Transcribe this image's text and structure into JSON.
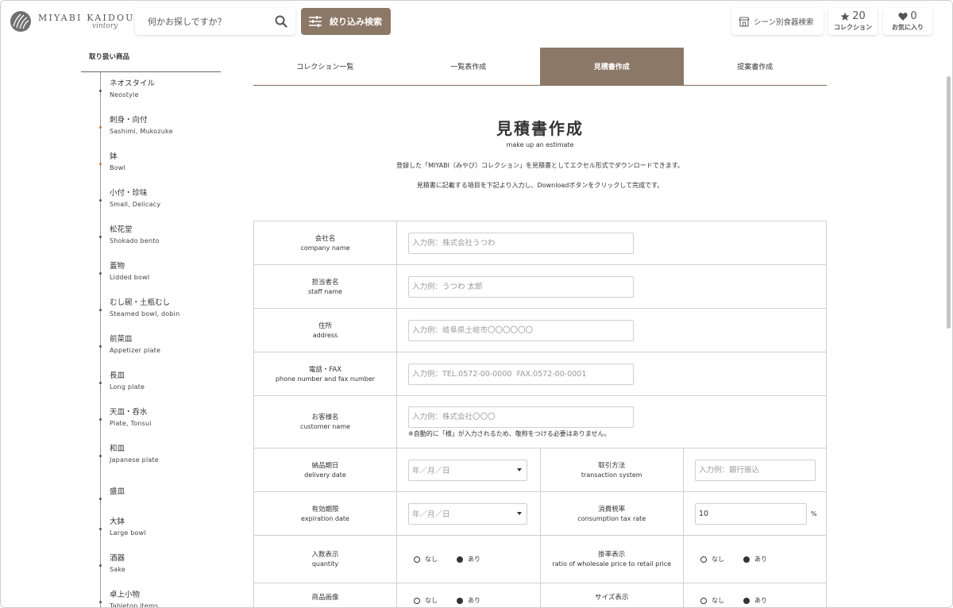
{
  "header": {
    "logo_main": "MIYABI KAIDOU",
    "logo_sub": "vintory",
    "search_placeholder": "何かお探しですか？",
    "filter_label": "絞り込み検索",
    "scene_label": "シーン別食器検索",
    "collection_count": "20",
    "collection_label": "コレクション",
    "favorites_count": "0",
    "favorites_label": "お気に入り"
  },
  "sidebar": {
    "title": "取り扱い商品",
    "items": [
      {
        "ja": "ネオスタイル",
        "en": "Neostyle"
      },
      {
        "ja": "刺身・向付",
        "en": "Sashimi, Mukozuke"
      },
      {
        "ja": "鉢",
        "en": "Bowl"
      },
      {
        "ja": "小付・珍味",
        "en": "Small, Delicacy"
      },
      {
        "ja": "松花堂",
        "en": "Shokado bento"
      },
      {
        "ja": "蓋物",
        "en": "Lidded bowl"
      },
      {
        "ja": "むし碗・土瓶むし",
        "en": "Steamed bowl, dobin"
      },
      {
        "ja": "前菜皿",
        "en": "Appetizer plate"
      },
      {
        "ja": "長皿",
        "en": "Long plate"
      },
      {
        "ja": "天皿・呑水",
        "en": "Plate, Tonsui"
      },
      {
        "ja": "和皿",
        "en": "Japanese plate"
      },
      {
        "ja": "盛皿",
        "en": ""
      },
      {
        "ja": "大鉢",
        "en": "Large bowl"
      },
      {
        "ja": "酒器",
        "en": "Sake"
      },
      {
        "ja": "卓上小物",
        "en": "Tabletop items"
      }
    ]
  },
  "tabs": [
    {
      "label": "コレクション一覧"
    },
    {
      "label": "一覧表作成"
    },
    {
      "label": "見積書作成"
    },
    {
      "label": "提案書作成"
    }
  ],
  "main": {
    "title": "見積書作成",
    "subtitle": "make up an estimate",
    "desc1": "登録した「MIYABI（みやび）コレクション」を見積書としてエクセル形式でダウンロードできます。",
    "desc2": "見積書に記載する項目を下記より入力し、Downloadボタンをクリックして完成です。"
  },
  "form": {
    "company": {
      "ja": "会社名",
      "en": "company name",
      "placeholder": "入力例：株式会社うつわ"
    },
    "staff": {
      "ja": "担当者名",
      "en": "staff name",
      "placeholder": "入力例：うつわ 太郎"
    },
    "address": {
      "ja": "住所",
      "en": "address",
      "placeholder": "入力例：岐阜県土岐市〇〇〇〇〇〇"
    },
    "phone": {
      "ja": "電話・FAX",
      "en": "phone number and fax number",
      "placeholder": "入力例：TEL.0572-00-0000  FAX.0572-00-0001"
    },
    "customer": {
      "ja": "お客様名",
      "en": "customer name",
      "placeholder": "入力例：株式会社〇〇〇",
      "note": "※自動的に「様」が入力されるため、敬称をつける必要はありません。"
    },
    "delivery": {
      "ja": "納品期日",
      "en": "delivery date",
      "value": "年／月／日"
    },
    "transaction": {
      "ja": "取引方法",
      "en": "transaction system",
      "placeholder": "入力例：銀行振込"
    },
    "expiration": {
      "ja": "有効期限",
      "en": "expiration date",
      "value": "年／月／日"
    },
    "tax": {
      "ja": "消費税率",
      "en": "consumption tax rate",
      "value": "10",
      "unit": "%"
    },
    "quantity": {
      "ja": "入数表示",
      "en": "quantity"
    },
    "ratio": {
      "ja": "掛率表示",
      "en": "ratio of wholesale price to retail price"
    },
    "image": {
      "ja": "商品画像"
    },
    "size": {
      "ja": "サイズ表示"
    },
    "opt_none": "なし",
    "opt_yes": "あり"
  }
}
